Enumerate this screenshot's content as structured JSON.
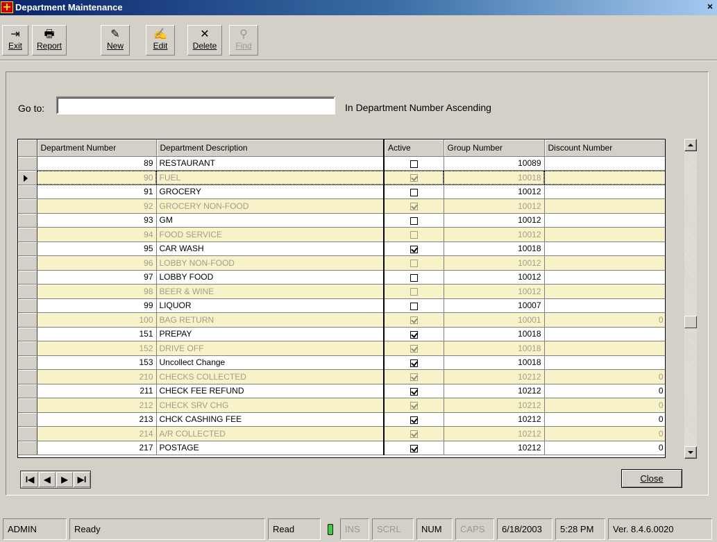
{
  "window": {
    "title": "Department Maintenance",
    "close_glyph": "×"
  },
  "toolbar": [
    {
      "label": "Exit",
      "icon": "exit-icon",
      "glyph": "⇥"
    },
    {
      "label": "Report",
      "icon": "printer-icon",
      "glyph": "🖶"
    },
    {
      "label": "New",
      "icon": "new-record-icon",
      "glyph": "✎"
    },
    {
      "label": "Edit",
      "icon": "edit-icon",
      "glyph": "✍"
    },
    {
      "label": "Delete",
      "icon": "delete-icon",
      "glyph": "✕"
    },
    {
      "label": "Find",
      "icon": "binoculars-icon",
      "glyph": "⚲",
      "disabled": true
    }
  ],
  "goto": {
    "label": "Go to:",
    "value": "",
    "sort_text": "In Department Number Ascending"
  },
  "grid": {
    "columns": [
      "Department Number",
      "Department Description",
      "Active",
      "Group Number",
      "Discount Number"
    ],
    "rows": [
      {
        "num": "89",
        "desc": "RESTAURANT",
        "active": false,
        "group": "10089",
        "discount": ""
      },
      {
        "num": "90",
        "desc": "FUEL",
        "active": true,
        "group": "10018",
        "discount": "",
        "current": true
      },
      {
        "num": "91",
        "desc": "GROCERY",
        "active": false,
        "group": "10012",
        "discount": ""
      },
      {
        "num": "92",
        "desc": "GROCERY NON-FOOD",
        "active": true,
        "group": "10012",
        "discount": ""
      },
      {
        "num": "93",
        "desc": "GM",
        "active": false,
        "group": "10012",
        "discount": ""
      },
      {
        "num": "94",
        "desc": "FOOD SERVICE",
        "active": false,
        "group": "10012",
        "discount": ""
      },
      {
        "num": "95",
        "desc": "CAR WASH",
        "active": true,
        "group": "10018",
        "discount": ""
      },
      {
        "num": "96",
        "desc": "LOBBY NON-FOOD",
        "active": false,
        "group": "10012",
        "discount": ""
      },
      {
        "num": "97",
        "desc": "LOBBY FOOD",
        "active": false,
        "group": "10012",
        "discount": ""
      },
      {
        "num": "98",
        "desc": "BEER & WINE",
        "active": false,
        "group": "10012",
        "discount": ""
      },
      {
        "num": "99",
        "desc": "LIQUOR",
        "active": false,
        "group": "10007",
        "discount": ""
      },
      {
        "num": "100",
        "desc": "BAG RETURN",
        "active": true,
        "group": "10001",
        "discount": "0"
      },
      {
        "num": "151",
        "desc": "PREPAY",
        "active": true,
        "group": "10018",
        "discount": ""
      },
      {
        "num": "152",
        "desc": "DRIVE OFF",
        "active": true,
        "group": "10018",
        "discount": ""
      },
      {
        "num": "153",
        "desc": "Uncollect Change",
        "active": true,
        "group": "10018",
        "discount": ""
      },
      {
        "num": "210",
        "desc": "CHECKS COLLECTED",
        "active": true,
        "group": "10212",
        "discount": "0"
      },
      {
        "num": "211",
        "desc": "CHECK FEE REFUND",
        "active": true,
        "group": "10212",
        "discount": "0"
      },
      {
        "num": "212",
        "desc": "CHECK SRV CHG",
        "active": true,
        "group": "10212",
        "discount": "0"
      },
      {
        "num": "213",
        "desc": "CHCK CASHING FEE",
        "active": true,
        "group": "10212",
        "discount": "0"
      },
      {
        "num": "214",
        "desc": "A/R COLLECTED",
        "active": true,
        "group": "10212",
        "discount": "0"
      },
      {
        "num": "217",
        "desc": "POSTAGE",
        "active": true,
        "group": "10212",
        "discount": "0"
      }
    ]
  },
  "nav": {
    "first": "I◀",
    "prev": "◀",
    "next": "▶",
    "last": "▶I"
  },
  "close_button": {
    "label": "Close"
  },
  "statusbar": {
    "user": "ADMIN",
    "message": "Ready",
    "mode": "Read",
    "ins": "INS",
    "scrl": "SCRL",
    "num": "NUM",
    "caps": "CAPS",
    "date": "6/18/2003",
    "time": "5:28 PM",
    "version": "Ver. 8.4.6.0020"
  },
  "colors": {
    "title_start": "#0a246a",
    "title_end": "#a6caf0",
    "alt_row": "#f8f2c8",
    "led": "#37d13a"
  }
}
